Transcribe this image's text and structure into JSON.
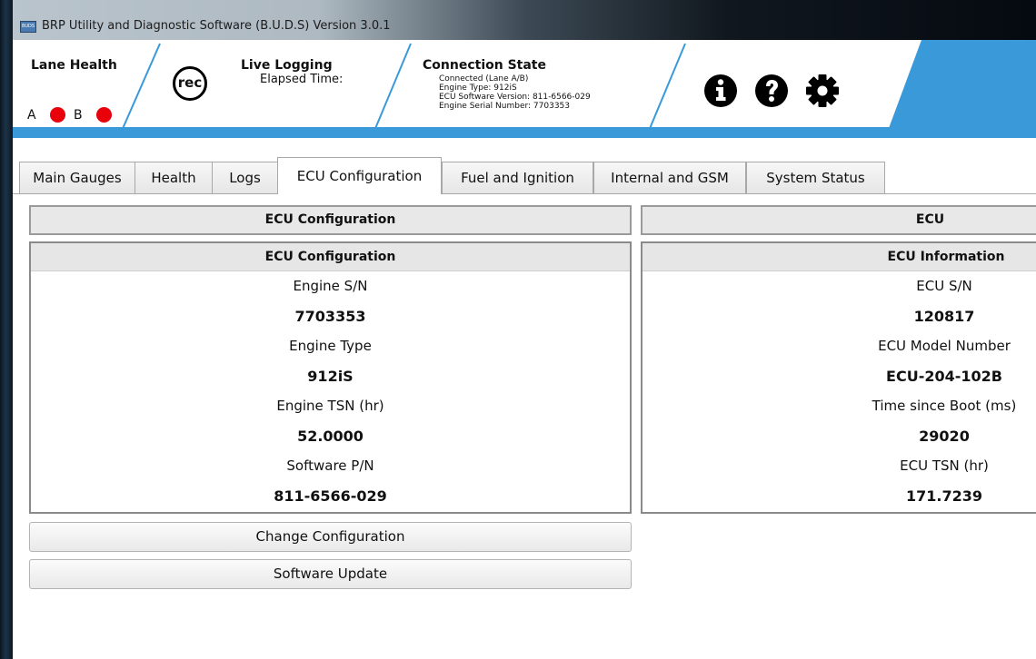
{
  "window": {
    "title": "BRP Utility and Diagnostic Software (B.U.D.S) Version 3.0.1",
    "icon": "buds-app-icon"
  },
  "header": {
    "lane_health": {
      "title": "Lane Health",
      "lane_a": "A",
      "lane_b": "B",
      "status_color": "#e8000b"
    },
    "live_logging": {
      "rec_label": "rec",
      "title": "Live Logging",
      "elapsed": "Elapsed Time:"
    },
    "connection_state": {
      "title": "Connection State",
      "lines": [
        "Connected (Lane A/B)",
        "Engine Type: 912iS",
        "ECU Software Version: 811-6566-029",
        "Engine Serial Number: 7703353"
      ]
    },
    "icons": [
      "info-icon",
      "help-icon",
      "settings-gear-icon"
    ],
    "accent_color": "#3a9ad9"
  },
  "tabs": [
    {
      "label": "Main Gauges"
    },
    {
      "label": "Health"
    },
    {
      "label": "Logs"
    },
    {
      "label": "ECU Configuration",
      "active": true
    },
    {
      "label": "Fuel and Ignition"
    },
    {
      "label": "Internal and GSM"
    },
    {
      "label": "System Status"
    }
  ],
  "left_panel": {
    "section_title": "ECU Configuration",
    "box_title": "ECU Configuration",
    "rows": [
      "Engine S/N",
      "7703353",
      "Engine Type",
      "912iS",
      "Engine TSN (hr)",
      "52.0000",
      "Software P/N",
      "811-6566-029"
    ]
  },
  "right_panel": {
    "section_title": "ECU",
    "box_title": "ECU Information",
    "rows": [
      "ECU S/N",
      "120817",
      "ECU Model Number",
      "ECU-204-102B",
      "Time since Boot (ms)",
      "29020",
      "ECU TSN (hr)",
      "171.7239"
    ]
  },
  "buttons": {
    "change_config": "Change Configuration",
    "software_update": "Software Update"
  }
}
